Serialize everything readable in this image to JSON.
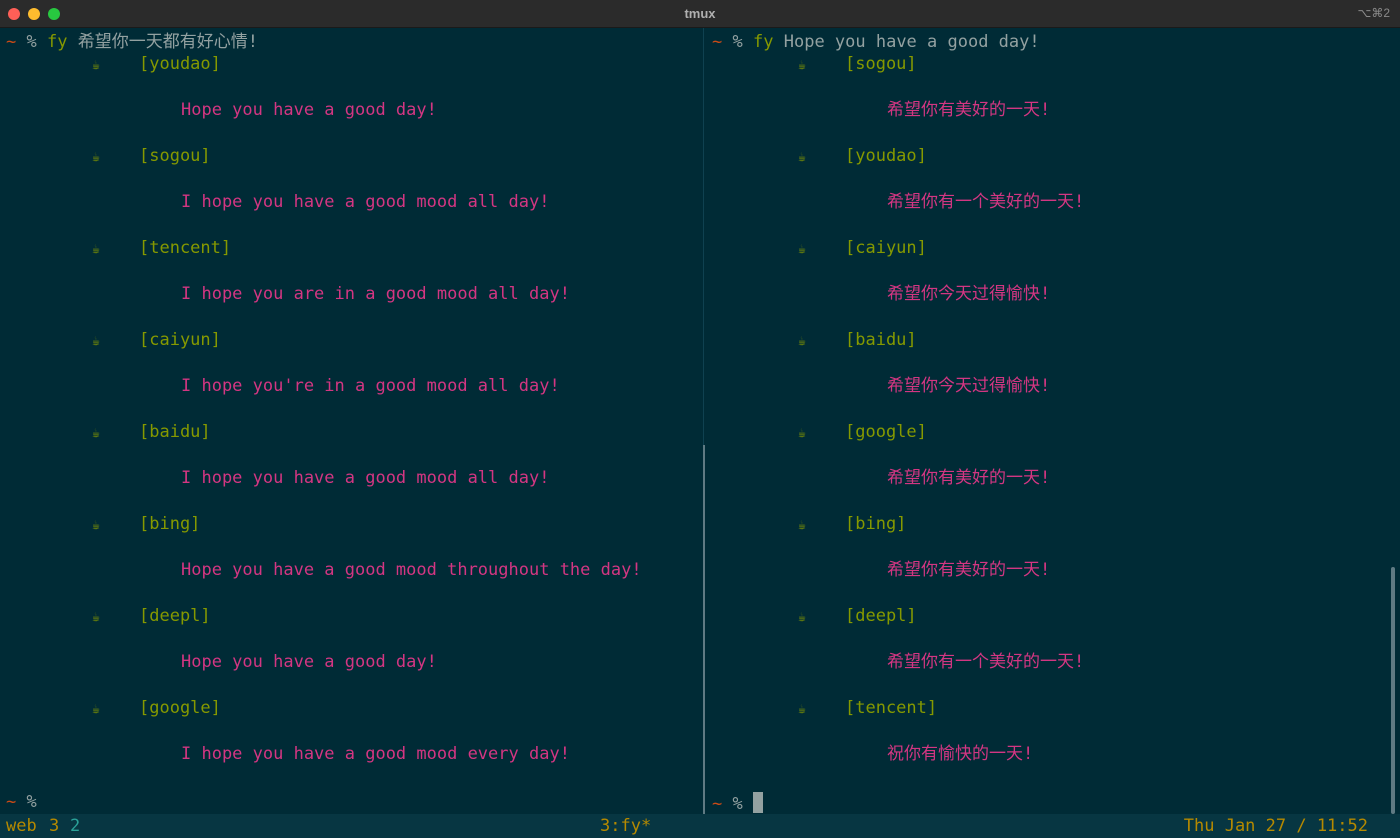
{
  "window": {
    "title": "tmux",
    "shortcut": "⌥⌘2"
  },
  "prompt": {
    "tilde": "~",
    "percent": "%"
  },
  "left_pane": {
    "command": "fy",
    "argument": "希望你一天都有好心情!",
    "results": [
      {
        "engine": "[youdao]",
        "text": "Hope you have a good day!"
      },
      {
        "engine": "[sogou]",
        "text": "I hope you have a good mood all day!"
      },
      {
        "engine": "[tencent]",
        "text": "I hope you are in a good mood all day!"
      },
      {
        "engine": "[caiyun]",
        "text": "I hope you're in a good mood all day!"
      },
      {
        "engine": "[baidu]",
        "text": "I hope you have a good mood all day!"
      },
      {
        "engine": "[bing]",
        "text": "Hope you have a good mood throughout the day!"
      },
      {
        "engine": "[deepl]",
        "text": "Hope you have a good day!"
      },
      {
        "engine": "[google]",
        "text": "I hope you have a good mood every day!"
      }
    ]
  },
  "right_pane": {
    "command": "fy",
    "argument": "Hope you have a good day!",
    "results": [
      {
        "engine": "[sogou]",
        "text": "希望你有美好的一天!"
      },
      {
        "engine": "[youdao]",
        "text": "希望你有一个美好的一天!"
      },
      {
        "engine": "[caiyun]",
        "text": "希望你今天过得愉快!"
      },
      {
        "engine": "[baidu]",
        "text": "希望你今天过得愉快!"
      },
      {
        "engine": "[google]",
        "text": "希望你有美好的一天!"
      },
      {
        "engine": "[bing]",
        "text": "希望你有美好的一天!"
      },
      {
        "engine": "[deepl]",
        "text": "希望你有一个美好的一天!"
      },
      {
        "engine": "[tencent]",
        "text": "祝你有愉快的一天!"
      }
    ]
  },
  "engine_icon": "coffee-cup-icon",
  "engine_glyph": "☕",
  "status_bar": {
    "session": "web",
    "num1": "3",
    "num2": "2",
    "window": "3:fy*",
    "datetime": "Thu Jan 27 / 11:52"
  },
  "colors": {
    "background": "#002b36",
    "engine": "#859900",
    "result": "#d33682",
    "status": "#b58900",
    "prompt": "#cb4b16"
  }
}
